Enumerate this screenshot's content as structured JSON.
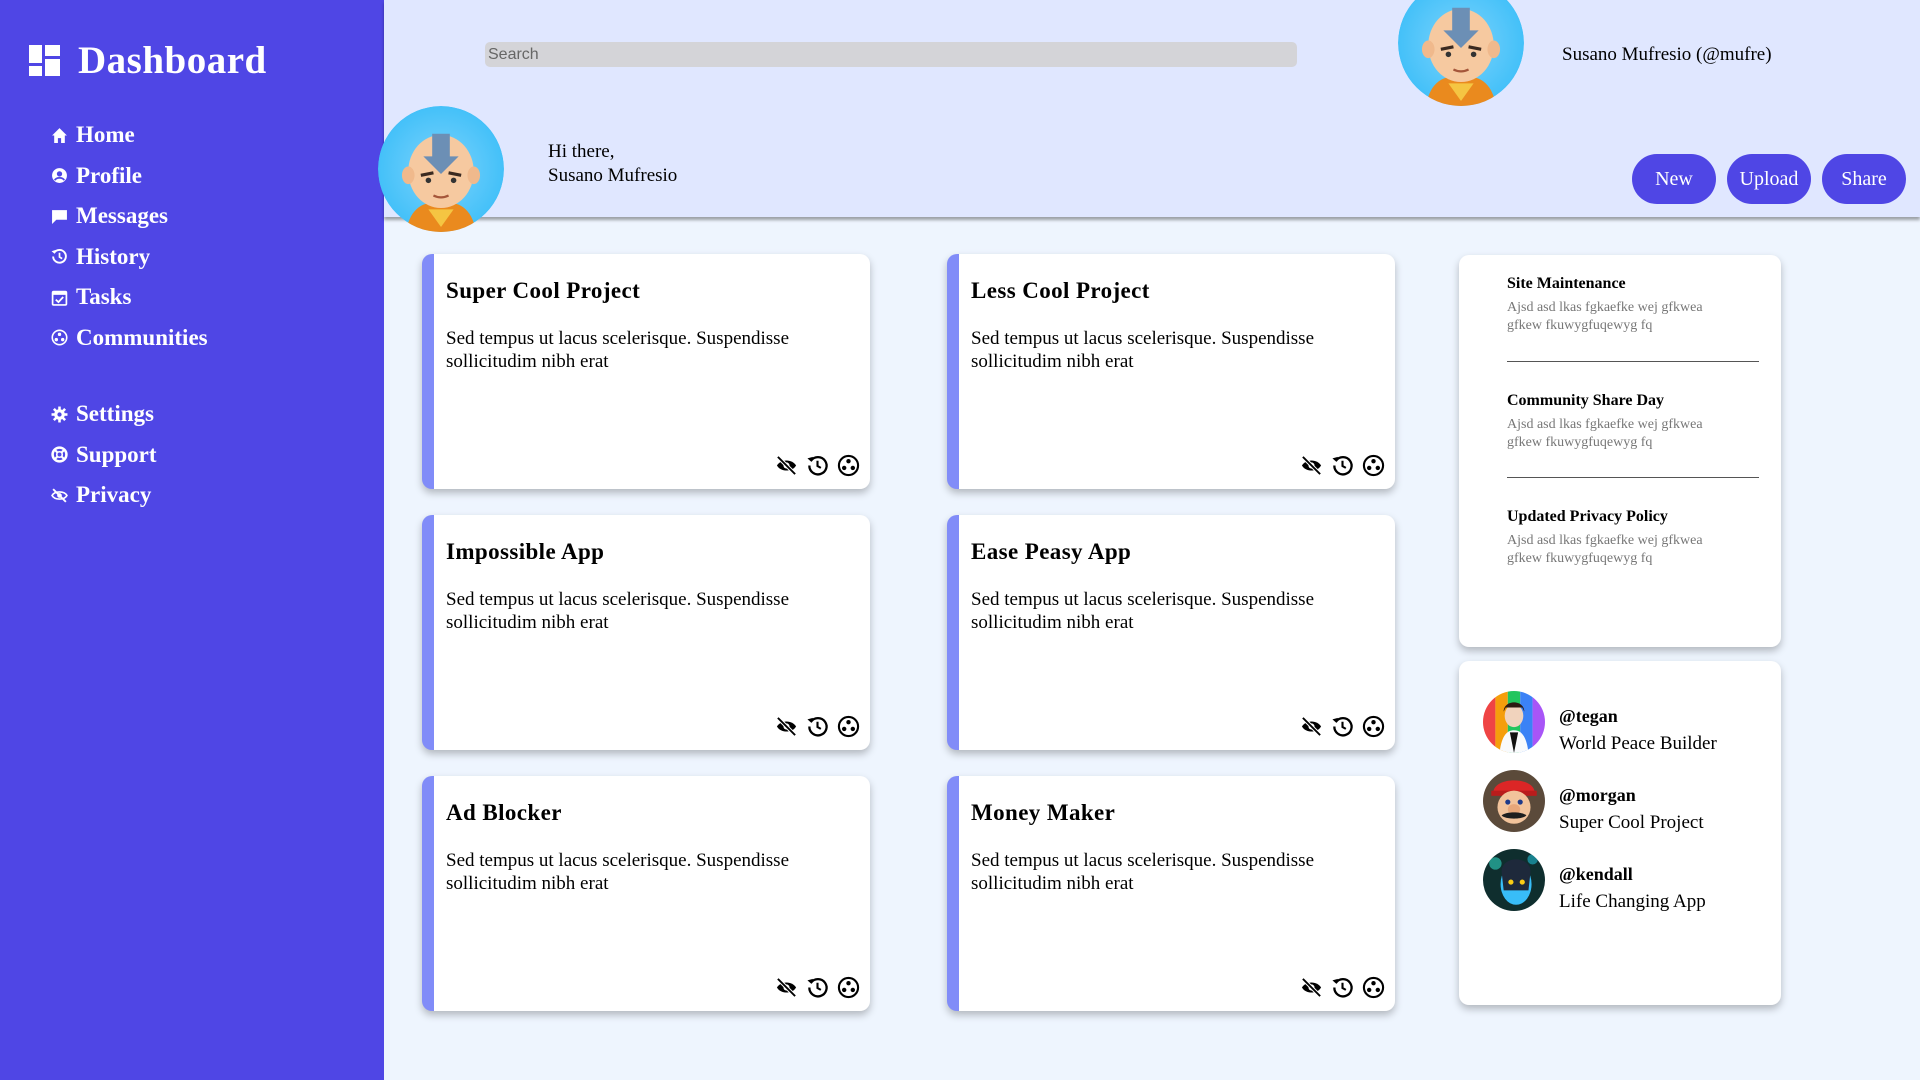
{
  "sidebar": {
    "brand": "Dashboard",
    "brand_icon": "dashboard-grid-icon",
    "primary": [
      {
        "label": "Home",
        "icon": "home-icon"
      },
      {
        "label": "Profile",
        "icon": "profile-icon"
      },
      {
        "label": "Messages",
        "icon": "messages-icon"
      },
      {
        "label": "History",
        "icon": "history-icon"
      },
      {
        "label": "Tasks",
        "icon": "tasks-icon"
      },
      {
        "label": "Communities",
        "icon": "communities-icon"
      }
    ],
    "secondary": [
      {
        "label": "Settings",
        "icon": "gear-icon"
      },
      {
        "label": "Support",
        "icon": "support-icon"
      },
      {
        "label": "Privacy",
        "icon": "privacy-icon"
      }
    ]
  },
  "header": {
    "search_placeholder": "Search",
    "user_display": "Susano Mufresio (@mufre)",
    "greeting_line1": "Hi there,",
    "greeting_line2": "Susano Mufresio",
    "buttons": {
      "new": "New",
      "upload": "Upload",
      "share": "Share"
    }
  },
  "projects": [
    {
      "title": "Super Cool Project",
      "desc": "Sed tempus ut lacus scelerisque. Suspendisse sollicitudim nibh erat"
    },
    {
      "title": "Less Cool Project",
      "desc": "Sed tempus ut lacus scelerisque. Suspendisse sollicitudim nibh erat"
    },
    {
      "title": "Impossible App",
      "desc": "Sed tempus ut lacus scelerisque. Suspendisse sollicitudim nibh erat"
    },
    {
      "title": "Ease Peasy App",
      "desc": "Sed tempus ut lacus scelerisque. Suspendisse sollicitudim nibh erat"
    },
    {
      "title": "Ad Blocker",
      "desc": "Sed tempus ut lacus scelerisque. Suspendisse sollicitudim nibh erat"
    },
    {
      "title": "Money Maker",
      "desc": "Sed tempus ut lacus scelerisque. Suspendisse sollicitudim nibh erat"
    }
  ],
  "announcements": [
    {
      "title": "Site Maintenance",
      "body": "Ajsd asd lkas fgkaefke wej gfkwea gfkew fkuwygfuqewyg fq"
    },
    {
      "title": "Community Share Day",
      "body": "Ajsd asd lkas fgkaefke wej gfkwea gfkew fkuwygfuqewyg fq"
    },
    {
      "title": "Updated Privacy Policy",
      "body": "Ajsd asd lkas fgkaefke wej gfkwea gfkew fkuwygfuqewyg fq"
    }
  ],
  "trending": [
    {
      "handle": "@tegan",
      "project": "World Peace Builder"
    },
    {
      "handle": "@morgan",
      "project": "Super Cool Project"
    },
    {
      "handle": "@kendall",
      "project": "Life Changing App"
    }
  ],
  "colors": {
    "sidebar": "#4f46e5",
    "header": "#e0e7ff",
    "background": "#eef5fe",
    "card_accent": "#818cf8"
  }
}
